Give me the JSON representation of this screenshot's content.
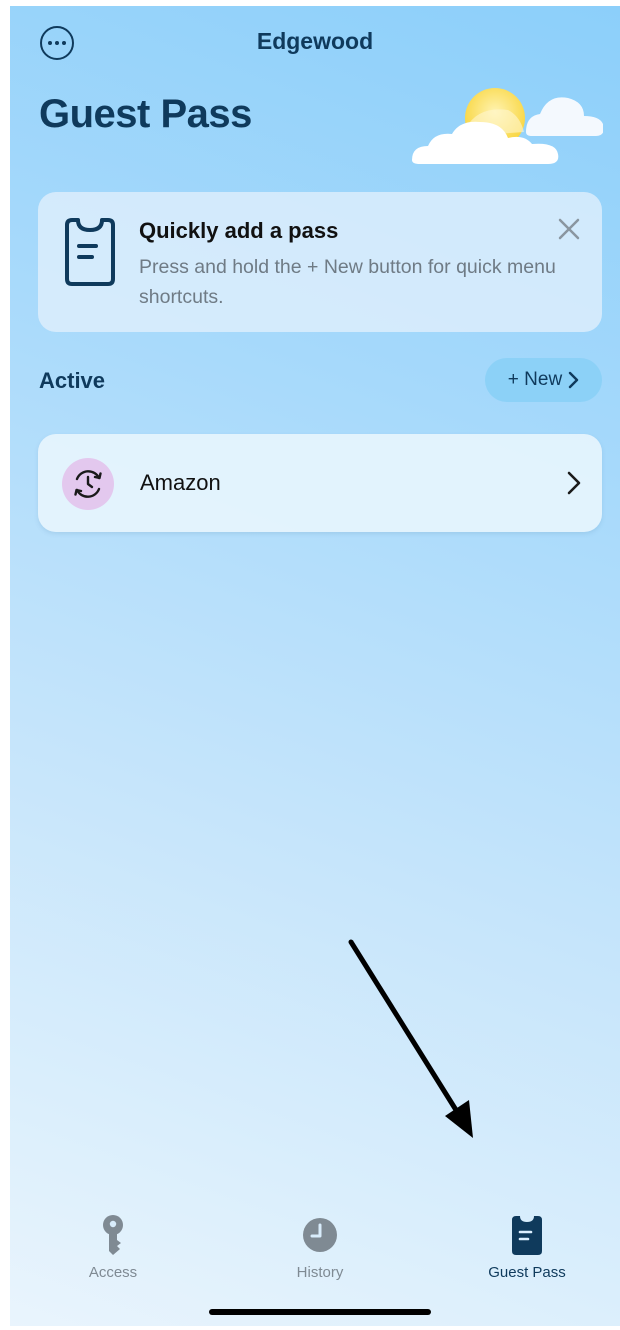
{
  "header": {
    "location": "Edgewood",
    "more_icon": "ellipsis-circle-icon",
    "page_title": "Guest Pass",
    "weather_icon": "partly-sunny-clouds-icon"
  },
  "tip_card": {
    "icon": "guest-pass-clipboard-icon",
    "title": "Quickly add a pass",
    "body": "Press and hold the + New button for quick menu shortcuts.",
    "close_icon": "close-icon"
  },
  "active_section": {
    "title": "Active",
    "new_button_label": "+ New",
    "passes": [
      {
        "label": "Amazon",
        "icon": "recurring-clock-icon"
      }
    ]
  },
  "tab_bar": {
    "tabs": [
      {
        "label": "Access",
        "icon": "key-icon",
        "active": false
      },
      {
        "label": "History",
        "icon": "clock-icon",
        "active": false
      },
      {
        "label": "Guest Pass",
        "icon": "guest-pass-icon",
        "active": true
      }
    ]
  },
  "colors": {
    "primary_text": "#0f3a5c",
    "new_button_bg": "#8cd1f7",
    "avatar_bg": "#e3c8ee",
    "inactive_tab": "#7f8a93"
  }
}
